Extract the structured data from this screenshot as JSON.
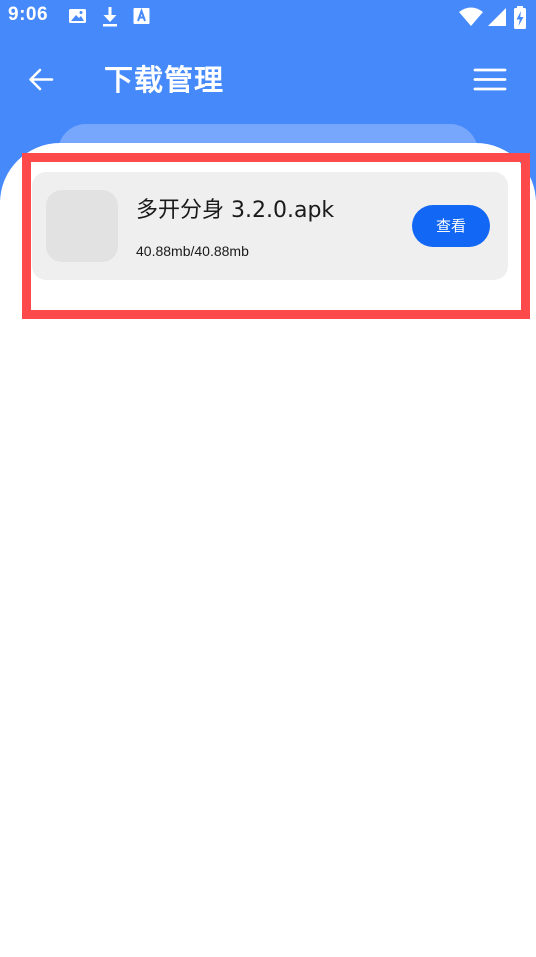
{
  "status_bar": {
    "time": "9:06",
    "left_icons": [
      "image-icon",
      "download-icon",
      "a-box-icon"
    ],
    "right_icons": [
      "wifi-icon",
      "signal-icon",
      "battery-charging-icon"
    ]
  },
  "app_bar": {
    "title": "下载管理",
    "back_icon": "arrow-left-icon",
    "menu_icon": "menu-icon"
  },
  "downloads": [
    {
      "file_name": "多开分身 3.2.0.apk",
      "size_progress": "40.88mb/40.88mb",
      "progress_fraction": 1.0,
      "action_label": "查看"
    }
  ],
  "colors": {
    "header_blue": "#4589fb",
    "tab_pill": "#77a7fc",
    "button_blue": "#1267f4",
    "card_bg": "#efefef",
    "highlight_red": "#ff4a4c"
  }
}
